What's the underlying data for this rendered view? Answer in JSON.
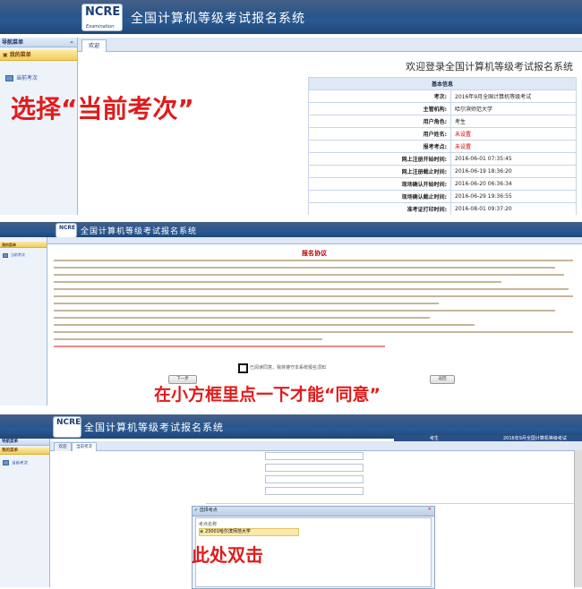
{
  "app": {
    "system_title": "全国计算机等级考试报名系统",
    "logo_text": "NCRE",
    "logo_sub": "Examination"
  },
  "sidebar": {
    "nav_title": "导航菜单",
    "my_menu": "我的菜单",
    "current_item": "当前考次"
  },
  "panel1": {
    "tab_home": "欢迎",
    "welcome": "欢迎登录全国计算机等级考试报名系统",
    "info_title": "基本信息",
    "rows": [
      {
        "label": "考次:",
        "value": "2016年9月全国计算机等级考试",
        "red": false
      },
      {
        "label": "主管机构:",
        "value": "哈尔滨师范大学",
        "red": false
      },
      {
        "label": "用户角色:",
        "value": "考生",
        "red": false
      },
      {
        "label": "用户姓名:",
        "value": "未设置",
        "red": true
      },
      {
        "label": "报考考点:",
        "value": "未设置",
        "red": true
      },
      {
        "label": "网上注册开始时间:",
        "value": "2016-06-01 07:35:45",
        "red": false
      },
      {
        "label": "网上注册截止时间:",
        "value": "2016-06-19 18:36:20",
        "red": false
      },
      {
        "label": "现场确认开始时间:",
        "value": "2016-06-20 06:36:34",
        "red": false
      },
      {
        "label": "现场确认截止时间:",
        "value": "2016-06-29 19:36:55",
        "red": false
      },
      {
        "label": "准考证打印时间:",
        "value": "2016-08-01 09:37:20",
        "red": false
      }
    ],
    "annotation": "选择“当前考次”"
  },
  "panel2": {
    "agreement_title": "报名协议",
    "agree_text": "已阅读同意，我将遵守本系统报名须知",
    "btn_left": "下一步",
    "btn_right": "返回",
    "annotation": "在小方框里点一下才能“同意”"
  },
  "panel3": {
    "tab_home": "欢迎",
    "tab_current": "当前考次",
    "header_user": "考生",
    "header_exam": "2016年9月全国计算机等级考试",
    "dialog_title": "选择考点",
    "list_header": "考点名称",
    "list_item": "23001哈尔滨师范大学",
    "annotation": "此处双击"
  },
  "colors": {
    "header_blue": "#2a5a93",
    "annotation_red": "#e01c1c",
    "menu_yellow": "#f2cf5a"
  }
}
